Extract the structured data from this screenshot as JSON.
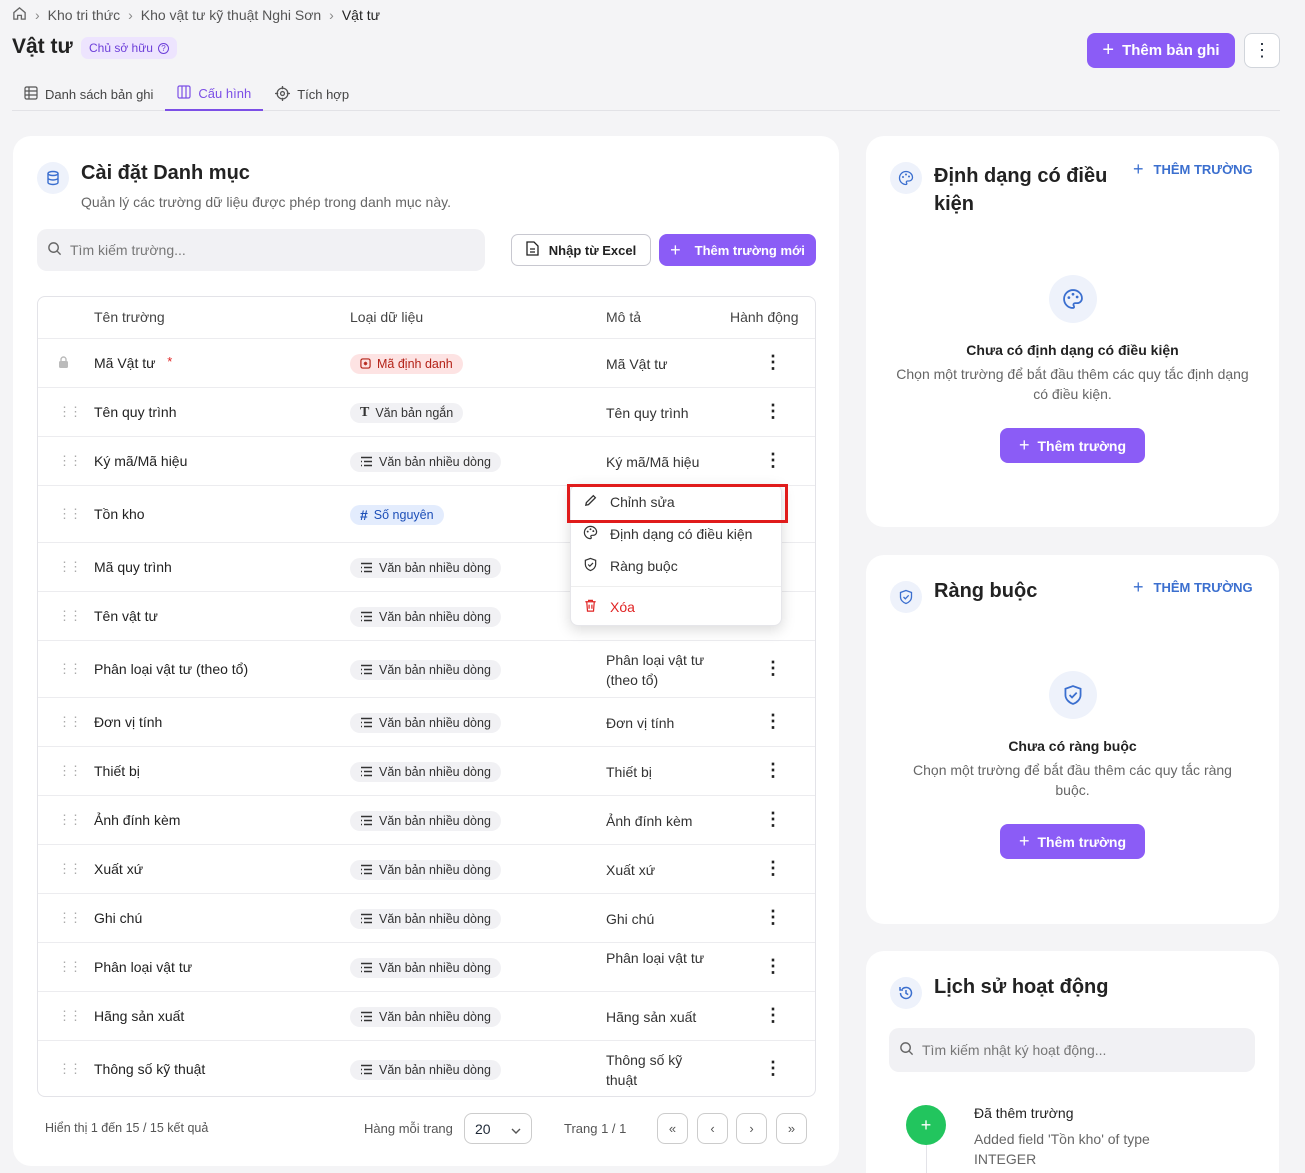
{
  "breadcrumb": {
    "items": [
      "Kho tri thức",
      "Kho vật tư kỹ thuật Nghi Sơn",
      "Vật tư"
    ]
  },
  "page": {
    "title": "Vật tư",
    "owner_badge": "Chủ sở hữu",
    "add_record": "Thêm bản ghi",
    "more": "⋮"
  },
  "tabs": [
    {
      "label": "Danh sách bản ghi"
    },
    {
      "label": "Cấu hình"
    },
    {
      "label": "Tích hợp"
    }
  ],
  "catalog": {
    "title": "Cài đặt Danh mục",
    "subtitle": "Quản lý các trường dữ liệu được phép trong danh mục này.",
    "search_placeholder": "Tìm kiếm trường...",
    "import_excel": "Nhập từ Excel",
    "add_field": "Thêm trường mới",
    "columns": {
      "name": "Tên trường",
      "type": "Loại dữ liệu",
      "desc": "Mô tả",
      "action": "Hành động"
    },
    "rows": [
      {
        "name": "Mã Vật tư",
        "required": "*",
        "type": "Mã định danh",
        "desc": "Mã Vật tư"
      },
      {
        "name": "Tên quy trình",
        "type": "Văn bản ngắn",
        "desc": "Tên quy trình"
      },
      {
        "name": "Ký mã/Mã hiệu",
        "type": "Văn bản nhiều dòng",
        "desc": "Ký mã/Mã hiệu"
      },
      {
        "name": "Tồn kho",
        "type": "Số nguyên",
        "desc": ""
      },
      {
        "name": "Mã quy trình",
        "type": "Văn bản nhiều dòng",
        "desc": ""
      },
      {
        "name": "Tên vật tư",
        "type": "Văn bản nhiều dòng",
        "desc": ""
      },
      {
        "name": "Phân loại vật tư (theo tổ)",
        "type": "Văn bản nhiều dòng",
        "desc": "Phân loại vật tư (theo tổ)"
      },
      {
        "name": "Đơn vị tính",
        "type": "Văn bản nhiều dòng",
        "desc": "Đơn vị tính"
      },
      {
        "name": "Thiết bị",
        "type": "Văn bản nhiều dòng",
        "desc": "Thiết bị"
      },
      {
        "name": "Ảnh đính kèm",
        "type": "Văn bản nhiều dòng",
        "desc": "Ảnh đính kèm"
      },
      {
        "name": "Xuất xứ",
        "type": "Văn bản nhiều dòng",
        "desc": "Xuất xứ"
      },
      {
        "name": "Ghi chú",
        "type": "Văn bản nhiều dòng",
        "desc": "Ghi chú"
      },
      {
        "name": "Phân loại vật tư",
        "type": "Văn bản nhiều dòng",
        "desc": "Phân loại vật tư"
      },
      {
        "name": "Hãng sản xuất",
        "type": "Văn bản nhiều dòng",
        "desc": "Hãng sản xuất"
      },
      {
        "name": "Thông số kỹ thuật",
        "type": "Văn bản nhiều dòng",
        "desc": "Thông số kỹ thuật"
      }
    ],
    "footer": {
      "summary": "Hiển thị 1 đến 15 / 15 kết quả",
      "per_page_label": "Hàng mỗi trang",
      "per_page_value": "20",
      "page_info": "Trang 1 / 1",
      "first": "«",
      "prev": "‹",
      "next": "›",
      "last": "»"
    }
  },
  "context_menu": {
    "edit": "Chỉnh sửa",
    "conditional_format": "Định dạng có điều kiện",
    "constraint": "Ràng buộc",
    "delete": "Xóa"
  },
  "conditional_format": {
    "title": "Định dạng có điều kiện",
    "add_link": "THÊM TRƯỜNG",
    "empty_title": "Chưa có định dạng có điều kiện",
    "empty_sub": "Chọn một trường để bắt đầu thêm các quy tắc định dạng có điều kiện.",
    "button": "Thêm trường"
  },
  "constraints": {
    "title": "Ràng buộc",
    "add_link": "THÊM TRƯỜNG",
    "empty_title": "Chưa có ràng buộc",
    "empty_sub": "Chọn một trường để bắt đầu thêm các quy tắc ràng buộc.",
    "button": "Thêm trường"
  },
  "history": {
    "title": "Lịch sử hoạt động",
    "search_placeholder": "Tìm kiếm nhật ký hoạt động...",
    "items": [
      {
        "title": "Đã thêm trường",
        "detail": "Added field 'Tồn kho' of type INTEGER"
      }
    ]
  },
  "colors": {
    "primary": "#8b5cf6",
    "accent_blue": "#3b6fcf",
    "danger": "#e01b1b"
  }
}
